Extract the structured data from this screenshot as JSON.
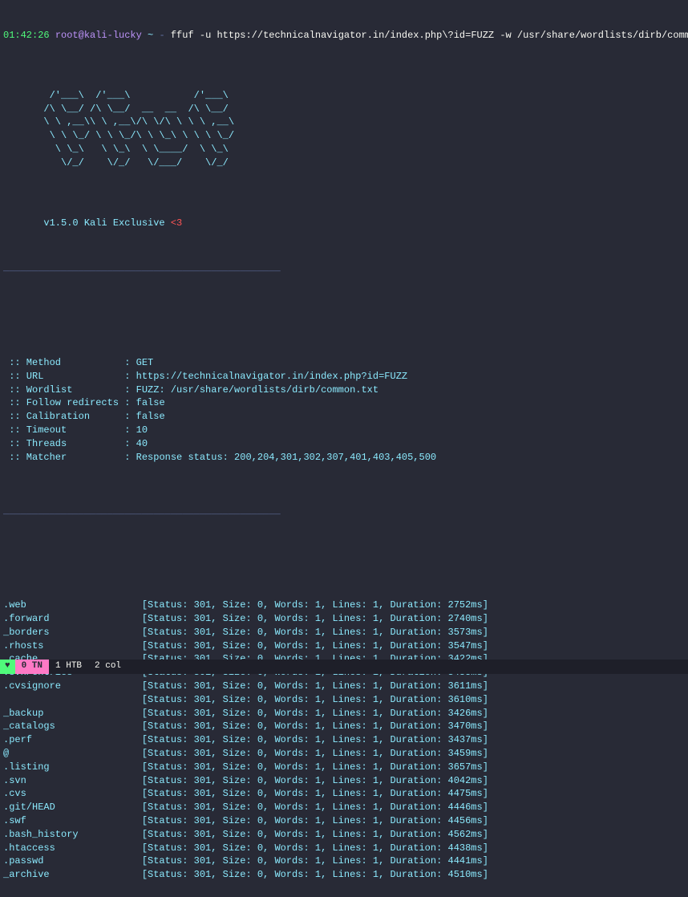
{
  "prompt": {
    "time": "01:42:26",
    "user_host": "root@kali-lucky",
    "path": "~",
    "separator": "-",
    "command": "ffuf -u https://technicalnavigator.in/index.php\\?id=FUZZ -w /usr/share/wordlists/dirb/common.txt"
  },
  "ascii_art": "        /'___\\  /'___\\           /'___\\\n       /\\ \\__/ /\\ \\__/  __  __  /\\ \\__/\n       \\ \\ ,__\\\\ \\ ,__\\/\\ \\/\\ \\ \\ \\ ,__\\\n        \\ \\ \\_/ \\ \\ \\_/\\ \\ \\_\\ \\ \\ \\ \\_/\n         \\ \\_\\   \\ \\_\\  \\ \\____/  \\ \\_\\\n          \\/_/    \\/_/   \\/___/    \\/_/",
  "version": "       v1.5.0 Kali Exclusive ",
  "version_heart": "<3",
  "divider": "________________________________________________",
  "config": [
    {
      "label": " :: Method           :",
      "value": " GET"
    },
    {
      "label": " :: URL              :",
      "value": " https://technicalnavigator.in/index.php?id=FUZZ"
    },
    {
      "label": " :: Wordlist         :",
      "value": " FUZZ: /usr/share/wordlists/dirb/common.txt"
    },
    {
      "label": " :: Follow redirects :",
      "value": " false"
    },
    {
      "label": " :: Calibration      :",
      "value": " false"
    },
    {
      "label": " :: Timeout          :",
      "value": " 10"
    },
    {
      "label": " :: Threads          :",
      "value": " 40"
    },
    {
      "label": " :: Matcher          :",
      "value": " Response status: 200,204,301,302,307,401,403,405,500"
    }
  ],
  "results": [
    {
      "name": ".web",
      "status": 301,
      "size": 0,
      "words": 1,
      "lines": 1,
      "duration": "2752ms"
    },
    {
      "name": ".forward",
      "status": 301,
      "size": 0,
      "words": 1,
      "lines": 1,
      "duration": "2740ms"
    },
    {
      "name": "_borders",
      "status": 301,
      "size": 0,
      "words": 1,
      "lines": 1,
      "duration": "3573ms"
    },
    {
      "name": ".rhosts",
      "status": 301,
      "size": 0,
      "words": 1,
      "lines": 1,
      "duration": "3547ms"
    },
    {
      "name": ".cache",
      "status": 301,
      "size": 0,
      "words": 1,
      "lines": 1,
      "duration": "3422ms"
    },
    {
      "name": ".svn/entries",
      "status": 301,
      "size": 0,
      "words": 1,
      "lines": 1,
      "duration": "3435ms"
    },
    {
      "name": ".cvsignore",
      "status": 301,
      "size": 0,
      "words": 1,
      "lines": 1,
      "duration": "3611ms"
    },
    {
      "name": "",
      "status": 301,
      "size": 0,
      "words": 1,
      "lines": 1,
      "duration": "3610ms"
    },
    {
      "name": "_backup",
      "status": 301,
      "size": 0,
      "words": 1,
      "lines": 1,
      "duration": "3426ms"
    },
    {
      "name": "_catalogs",
      "status": 301,
      "size": 0,
      "words": 1,
      "lines": 1,
      "duration": "3470ms"
    },
    {
      "name": ".perf",
      "status": 301,
      "size": 0,
      "words": 1,
      "lines": 1,
      "duration": "3437ms"
    },
    {
      "name": "@",
      "status": 301,
      "size": 0,
      "words": 1,
      "lines": 1,
      "duration": "3459ms"
    },
    {
      "name": ".listing",
      "status": 301,
      "size": 0,
      "words": 1,
      "lines": 1,
      "duration": "3657ms"
    },
    {
      "name": ".svn",
      "status": 301,
      "size": 0,
      "words": 1,
      "lines": 1,
      "duration": "4042ms"
    },
    {
      "name": ".cvs",
      "status": 301,
      "size": 0,
      "words": 1,
      "lines": 1,
      "duration": "4475ms"
    },
    {
      "name": ".git/HEAD",
      "status": 301,
      "size": 0,
      "words": 1,
      "lines": 1,
      "duration": "4446ms"
    },
    {
      "name": ".swf",
      "status": 301,
      "size": 0,
      "words": 1,
      "lines": 1,
      "duration": "4456ms"
    },
    {
      "name": ".bash_history",
      "status": 301,
      "size": 0,
      "words": 1,
      "lines": 1,
      "duration": "4562ms"
    },
    {
      "name": ".htaccess",
      "status": 301,
      "size": 0,
      "words": 1,
      "lines": 1,
      "duration": "4438ms"
    },
    {
      "name": ".passwd",
      "status": 301,
      "size": 0,
      "words": 1,
      "lines": 1,
      "duration": "4441ms"
    },
    {
      "name": "_archive",
      "status": 301,
      "size": 0,
      "words": 1,
      "lines": 1,
      "duration": "4510ms"
    }
  ],
  "statusbar": {
    "heart": "♥",
    "tab": "0 TN",
    "item1": "1 HTB",
    "item2": "2 col"
  }
}
